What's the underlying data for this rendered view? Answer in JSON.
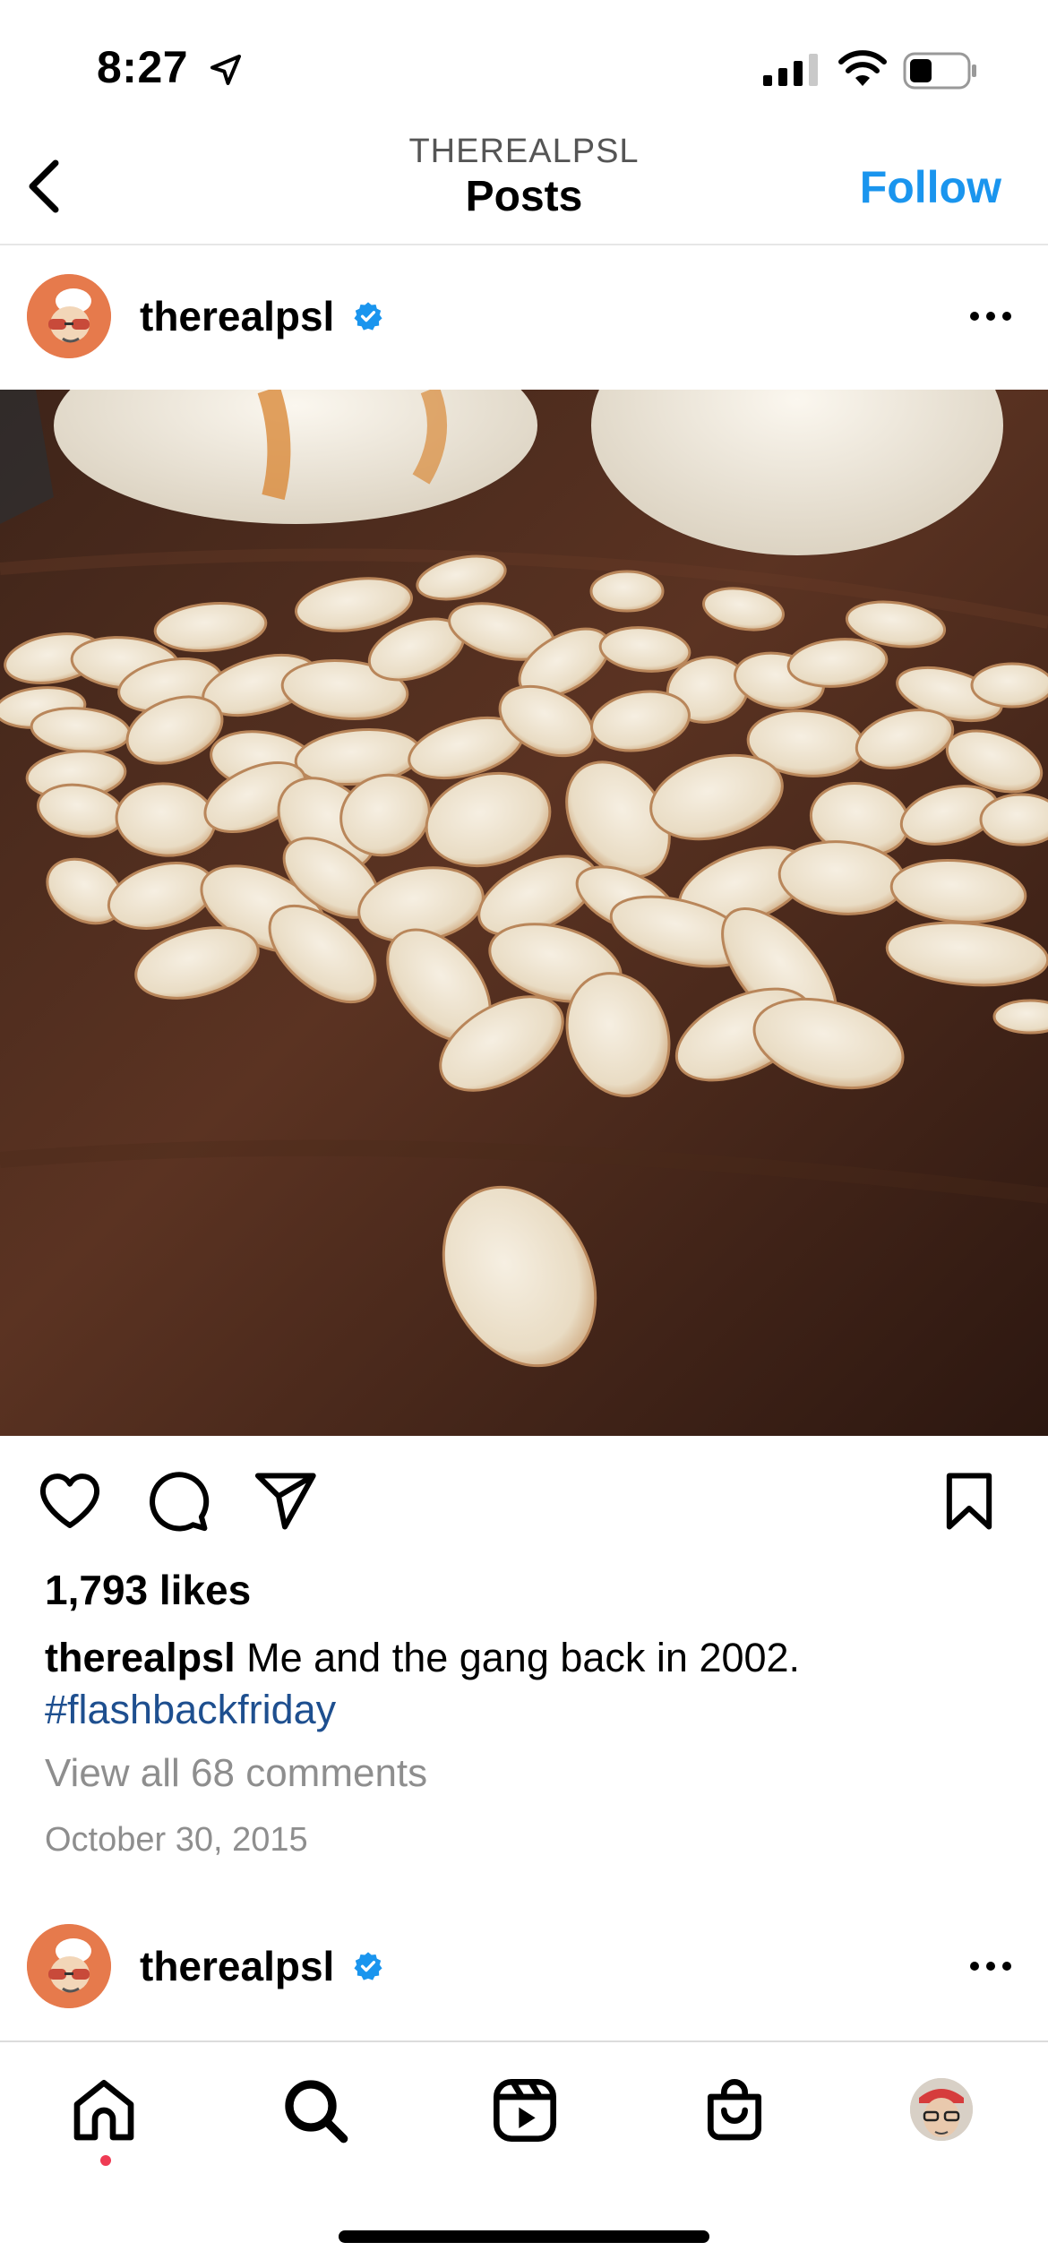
{
  "status_bar": {
    "time": "8:27"
  },
  "header": {
    "subtitle": "THEREALPSL",
    "title": "Posts",
    "follow_label": "Follow"
  },
  "post": {
    "username": "therealpsl",
    "likes": "1,793 likes",
    "caption_user": "therealpsl",
    "caption_text": " Me and the gang back in 2002.",
    "hashtag": "#flashbackfriday",
    "view_comments": "View all 68 comments",
    "date": "October 30, 2015"
  },
  "next_post": {
    "username": "therealpsl"
  },
  "icons": {
    "status": [
      "location-arrow-icon",
      "signal-icon",
      "wifi-icon",
      "battery-icon"
    ],
    "header": [
      "back-chevron-icon"
    ],
    "post": [
      "verified-badge-icon",
      "more-options-icon",
      "heart-icon",
      "comment-icon",
      "share-icon",
      "bookmark-icon"
    ],
    "tabs": [
      "home-icon",
      "search-icon",
      "reels-icon",
      "shop-icon",
      "profile-avatar"
    ]
  },
  "colors": {
    "accent": "#1a95ee",
    "hashtag": "#1e4f8f",
    "muted": "#8e8e8e",
    "verified": "#1a95ee",
    "notification_dot": "#ef3b54"
  }
}
